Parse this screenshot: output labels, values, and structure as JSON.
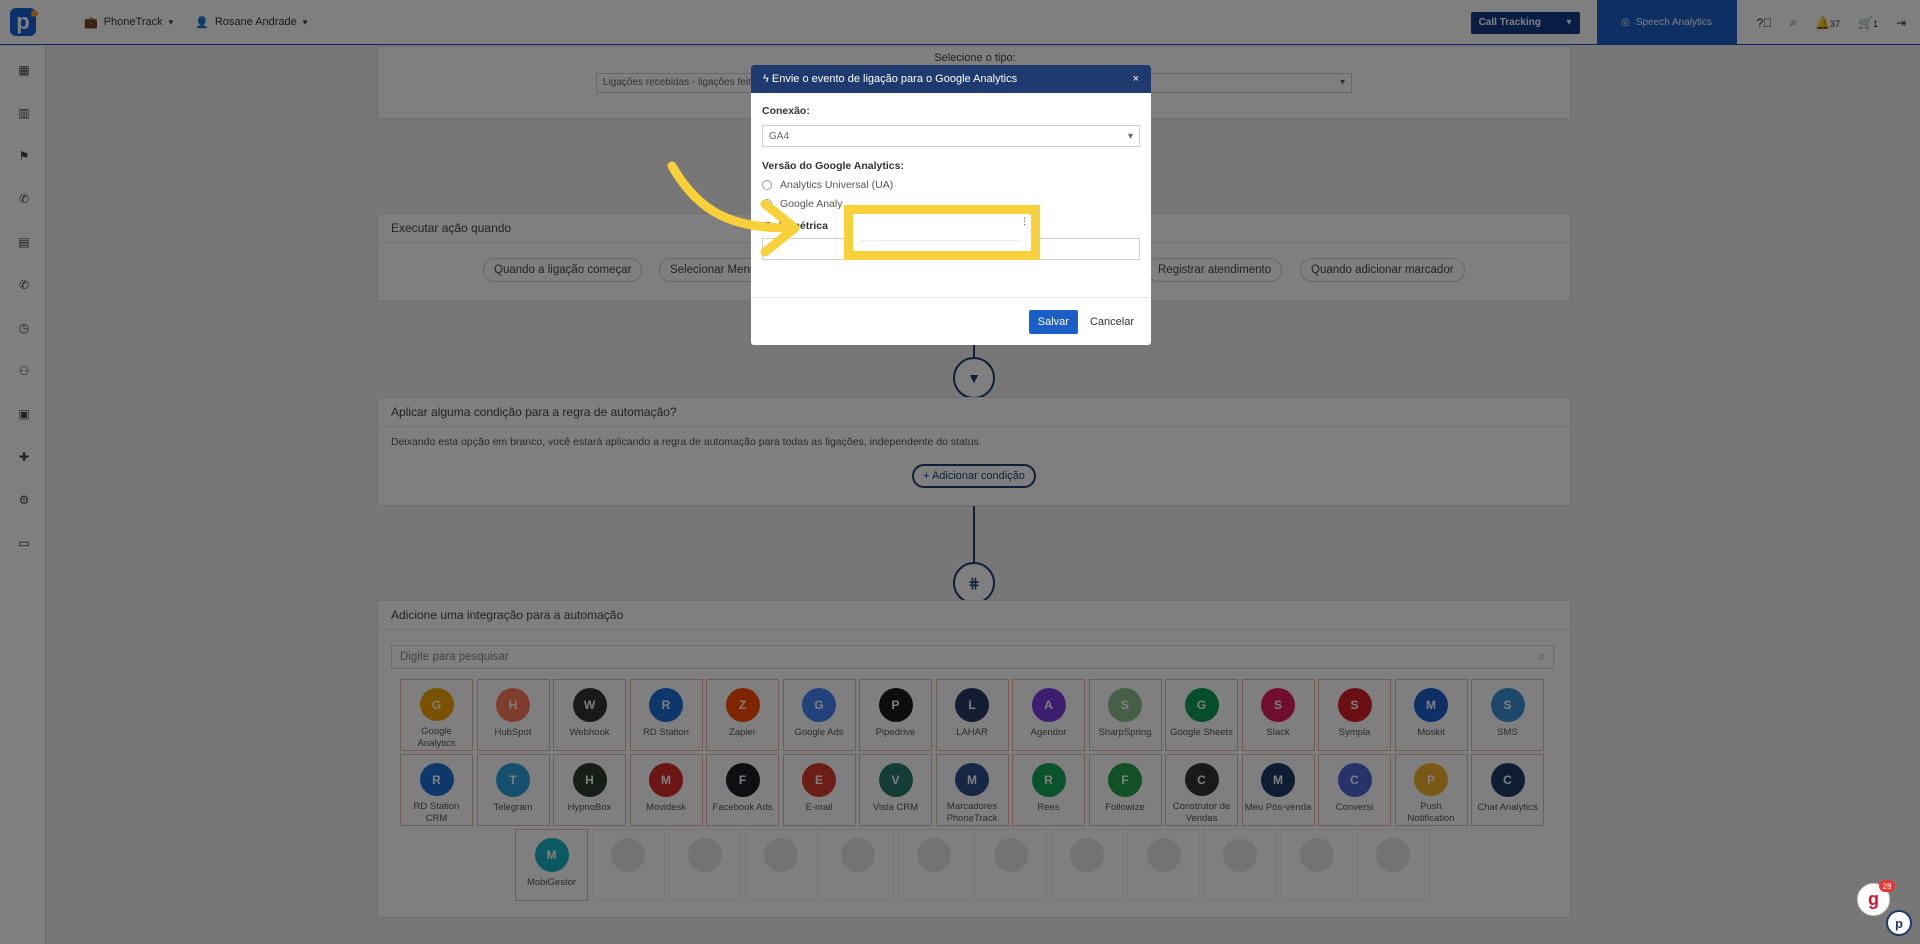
{
  "topbar": {
    "account": "PhoneTrack",
    "user": "Rosane Andrade",
    "call_tracking_label": "Call Tracking",
    "speech_analytics_label": "Speech Analytics",
    "notifications_count": "37",
    "cart_count": "1"
  },
  "sidebar": {
    "icons": [
      "dashboard-icon",
      "building-icon",
      "flag-icon",
      "phone-icon",
      "id-card-icon",
      "phone-outgoing-icon",
      "clock-icon",
      "users-icon",
      "book-icon",
      "puzzle-icon",
      "gear-icon",
      "store-icon"
    ]
  },
  "type_panel": {
    "label": "Selecione o tipo:",
    "select_value": "Ligações recebidas - ligações feit"
  },
  "trigger_panel": {
    "title": "Executar ação quando",
    "chips": [
      "Quando a ligação começar",
      "Selecionar Menu",
      "Registrar atendimento",
      "Quando adicionar marcador"
    ]
  },
  "condition_panel": {
    "title": "Aplicar alguma condição para a regra de automação?",
    "description": "Deixando esta opção em branco, você estará aplicando a regra de automação para todas as ligações, independente do status.",
    "add_button": "+ Adicionar condição"
  },
  "integration_panel": {
    "title": "Adicione uma integração para a automação",
    "search_placeholder": "Digite para pesquisar",
    "row1": [
      {
        "name": "Google Analytics",
        "color": "#f4a300"
      },
      {
        "name": "HubSpot",
        "color": "#ff7a59"
      },
      {
        "name": "Webhook",
        "color": "#333333"
      },
      {
        "name": "RD Station",
        "color": "#1c6ed6"
      },
      {
        "name": "Zapier",
        "color": "#ff4a00"
      },
      {
        "name": "Google Ads",
        "color": "#4285f4"
      },
      {
        "name": "Pipedrive",
        "color": "#1a1a1a"
      },
      {
        "name": "LAHAR",
        "color": "#2b3a66"
      },
      {
        "name": "Agendor",
        "color": "#7b3fe4"
      },
      {
        "name": "SharpSpring",
        "color": "#8cbf8c"
      },
      {
        "name": "Google Sheets",
        "color": "#0f9d58"
      },
      {
        "name": "Slack",
        "color": "#e01e5a"
      },
      {
        "name": "Sympla",
        "color": "#d4202a"
      },
      {
        "name": "Moskit",
        "color": "#1e5fcf"
      },
      {
        "name": "SMS",
        "color": "#3b8ed6"
      }
    ],
    "row2": [
      {
        "name": "RD Station CRM",
        "color": "#1c6ed6"
      },
      {
        "name": "Telegram",
        "color": "#2aa3df"
      },
      {
        "name": "HypnoBox",
        "color": "#2e3b2e"
      },
      {
        "name": "Movidesk",
        "color": "#d92a2a"
      },
      {
        "name": "Facebook Ads",
        "color": "#1d1f26"
      },
      {
        "name": "E-mail",
        "color": "#d93b2a"
      },
      {
        "name": "Vista CRM",
        "color": "#2a7a6e"
      },
      {
        "name": "Marcadores PhoneTrack",
        "color": "#2b4e8a"
      },
      {
        "name": "Rees",
        "color": "#16a65a"
      },
      {
        "name": "Followize",
        "color": "#22a34a"
      },
      {
        "name": "Construtor de Vendas",
        "color": "#333333"
      },
      {
        "name": "Meu Pós-venda",
        "color": "#1f3a66"
      },
      {
        "name": "Conversi",
        "color": "#4c68d7"
      },
      {
        "name": "Push Notification",
        "color": "#f2b32b"
      },
      {
        "name": "Chat Analytics",
        "color": "#1f3a66"
      }
    ],
    "row3": [
      {
        "name": "MobiGestor",
        "color": "#1bb3c4"
      }
    ],
    "row3_faded_count": 11
  },
  "modal": {
    "title": "Envie o evento de ligação para o Google Analytics",
    "connection_label": "Conexão:",
    "connection_value": "GA4",
    "version_label": "Versão do Google Analytics:",
    "option_ua": "Analytics Universal (UA)",
    "option_ga4": "Google Analy",
    "metric_label": "ID da métrica",
    "save_label": "Salvar",
    "cancel_label": "Cancelar",
    "close_glyph": "×"
  },
  "widgets": {
    "help_badge": "28"
  },
  "colors": {
    "primary": "#1a5fc8",
    "navy": "#1e3a6e",
    "highlight": "#f8d03a"
  }
}
